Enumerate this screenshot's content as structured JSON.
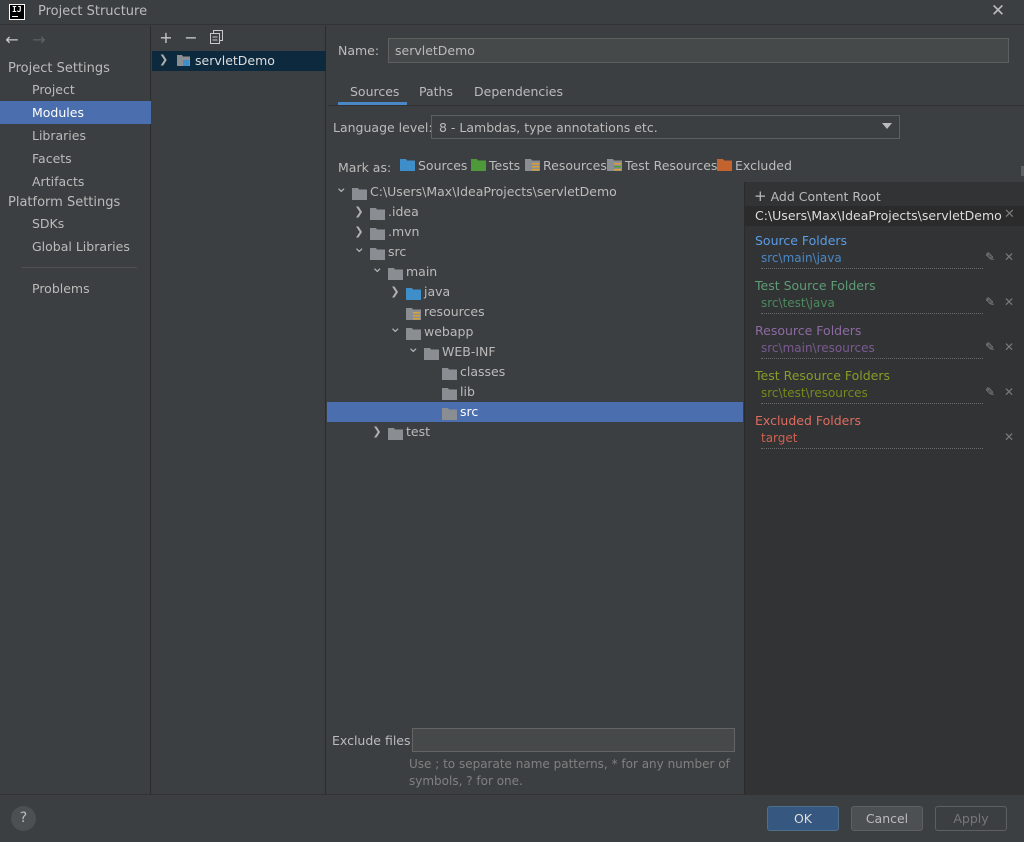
{
  "window": {
    "title": "Project Structure",
    "logo_text": "IJ"
  },
  "nav": {
    "back_icon": "arrow-left-icon",
    "forward_icon": "arrow-right-icon",
    "project_settings_header": "Project Settings",
    "project_settings_items": [
      "Project",
      "Modules",
      "Libraries",
      "Facets",
      "Artifacts"
    ],
    "platform_settings_header": "Platform Settings",
    "platform_settings_items": [
      "SDKs",
      "Global Libraries"
    ],
    "problems": "Problems",
    "selected": "Modules"
  },
  "modules": {
    "toolbar": [
      "add-icon",
      "remove-icon",
      "copy-icon"
    ],
    "items": [
      {
        "label": "servletDemo",
        "selected": true
      }
    ]
  },
  "main": {
    "name_label": "Name:",
    "name_value": "servletDemo",
    "tabs": [
      "Sources",
      "Paths",
      "Dependencies"
    ],
    "active_tab": "Sources",
    "language_level_label": "Language level:",
    "language_level_value": "8 - Lambdas, type annotations etc.",
    "mark_as_label": "Mark as:",
    "mark_as": [
      "Sources",
      "Tests",
      "Resources",
      "Test Resources",
      "Excluded"
    ]
  },
  "tree": {
    "nodes": [
      {
        "label": "C:\\Users\\Max\\IdeaProjects\\servletDemo",
        "depth": 0,
        "expander": "expanded",
        "icon": "folder-icon"
      },
      {
        "label": ".idea",
        "depth": 1,
        "expander": "collapsed",
        "icon": "folder-icon"
      },
      {
        "label": ".mvn",
        "depth": 1,
        "expander": "collapsed",
        "icon": "folder-icon"
      },
      {
        "label": "src",
        "depth": 1,
        "expander": "expanded",
        "icon": "folder-icon"
      },
      {
        "label": "main",
        "depth": 2,
        "expander": "expanded",
        "icon": "folder-icon"
      },
      {
        "label": "java",
        "depth": 3,
        "expander": "collapsed",
        "icon": "source-folder-icon"
      },
      {
        "label": "resources",
        "depth": 3,
        "expander": "none",
        "icon": "resources-folder-icon"
      },
      {
        "label": "webapp",
        "depth": 3,
        "expander": "expanded",
        "icon": "folder-icon"
      },
      {
        "label": "WEB-INF",
        "depth": 4,
        "expander": "expanded",
        "icon": "folder-icon"
      },
      {
        "label": "classes",
        "depth": 5,
        "expander": "none",
        "icon": "folder-icon"
      },
      {
        "label": "lib",
        "depth": 5,
        "expander": "none",
        "icon": "folder-icon"
      },
      {
        "label": "src",
        "depth": 5,
        "expander": "none",
        "icon": "folder-icon",
        "selected": true
      },
      {
        "label": "test",
        "depth": 2,
        "expander": "collapsed",
        "icon": "folder-icon"
      }
    ]
  },
  "roots": {
    "add_content_root": "Add Content Root",
    "root_path": "C:\\Users\\Max\\IdeaProjects\\servletDemo",
    "sections": [
      {
        "title": "Source Folders",
        "path": "src\\main\\java",
        "color": "#5a9de6",
        "path_color": "#4a88c7",
        "editable": true
      },
      {
        "title": "Test Source Folders",
        "path": "src\\test\\java",
        "color": "#5e9c76",
        "path_color": "#4e8a5f",
        "editable": true
      },
      {
        "title": "Resource Folders",
        "path": "src\\main\\resources",
        "color": "#8e6aa3",
        "path_color": "#7b5a91",
        "editable": true
      },
      {
        "title": "Test Resource Folders",
        "path": "src\\test\\resources",
        "color": "#8a9b29",
        "path_color": "#768a1a",
        "editable": true
      },
      {
        "title": "Excluded Folders",
        "path": "target",
        "color": "#e06c5e",
        "path_color": "#d0604e",
        "editable": false
      }
    ]
  },
  "exclude": {
    "label": "Exclude files:",
    "value": "",
    "hint": "Use ; to separate name patterns, * for any number of symbols, ? for one."
  },
  "buttons": {
    "help": "?",
    "ok": "OK",
    "cancel": "Cancel",
    "apply": "Apply"
  },
  "colors": {
    "folder": "#8a8e92",
    "source_folder": "#3d8ec9",
    "test_folder": "#4e9a3a",
    "excluded_folder": "#c3632e",
    "selection": "#4b6eaf",
    "accent": "#4a88c7"
  }
}
